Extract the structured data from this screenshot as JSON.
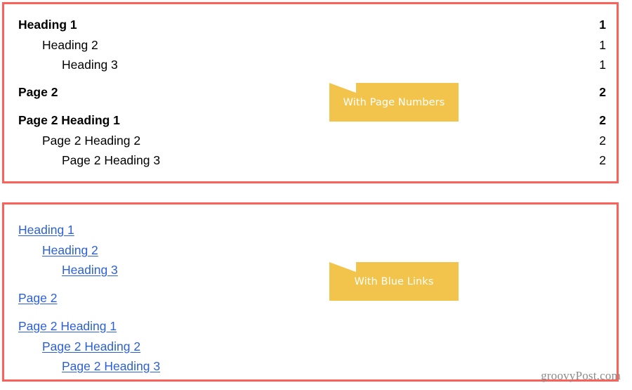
{
  "colors": {
    "panel_border": "#fb6158",
    "callout_bg": "#f2c44b",
    "callout_text": "#ffffff",
    "link_blue": "#2b5fd9",
    "text_black": "#000000",
    "watermark_gray": "#8b8b8b",
    "page_bg": "#ffffff"
  },
  "panel_page_numbers": {
    "callout": {
      "label": "With Page Numbers",
      "icon": "page-fold-icon"
    },
    "entries": [
      {
        "label": "Heading 1",
        "level": 1,
        "page": "1"
      },
      {
        "label": "Heading 2",
        "level": 2,
        "page": "1"
      },
      {
        "label": "Heading 3",
        "level": 3,
        "page": "1"
      },
      {
        "label": "Page 2",
        "level": 1,
        "page": "2"
      },
      {
        "label": "Page 2 Heading 1",
        "level": 1,
        "page": "2"
      },
      {
        "label": "Page 2 Heading 2",
        "level": 2,
        "page": "2"
      },
      {
        "label": "Page 2 Heading 3",
        "level": 3,
        "page": "2"
      }
    ]
  },
  "panel_blue_links": {
    "callout": {
      "label": "With Blue Links",
      "icon": "page-fold-icon"
    },
    "entries": [
      {
        "label": "Heading 1",
        "level": 1
      },
      {
        "label": "Heading 2",
        "level": 2
      },
      {
        "label": "Heading 3",
        "level": 3
      },
      {
        "label": "Page 2",
        "level": 1
      },
      {
        "label": "Page 2 Heading 1",
        "level": 1
      },
      {
        "label": "Page 2 Heading 2",
        "level": 2
      },
      {
        "label": "Page 2 Heading 3",
        "level": 3
      }
    ]
  },
  "watermark": {
    "text": "groovyPost.com"
  }
}
